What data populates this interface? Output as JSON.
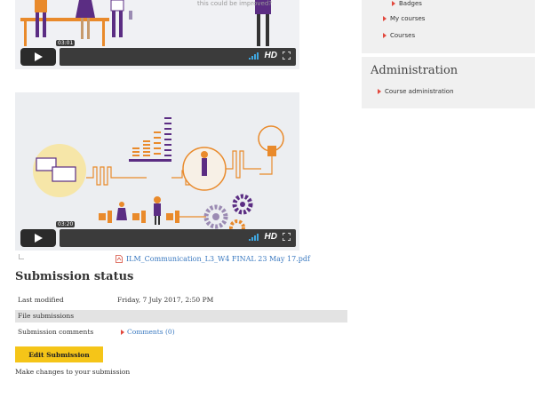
{
  "videos": [
    {
      "time": "03:01",
      "hd": "HD",
      "caption": "this could be improved?"
    },
    {
      "time": "03:20",
      "hd": "HD"
    }
  ],
  "attachment": {
    "filename": "ILM_Communication_L3_W4 FINAL 23 May 17.pdf"
  },
  "submission": {
    "title": "Submission status",
    "rows": [
      {
        "label": "Last modified",
        "value": "Friday, 7 July 2017, 2:50 PM"
      },
      {
        "label": "File submissions",
        "value": ""
      },
      {
        "label": "Submission comments",
        "value": "Comments (0)"
      }
    ],
    "edit_button": "Edit Submission",
    "help_text": "Make changes to your submission"
  },
  "navigation": {
    "items": [
      "Badges",
      "My courses",
      "Courses"
    ]
  },
  "administration": {
    "title": "Administration",
    "items": [
      "Course administration"
    ]
  },
  "colors": {
    "accent": "#f5c518",
    "link": "#3a79c0",
    "arrow": "#e2473c",
    "orange": "#e98a2b",
    "purple": "#5b2d83"
  }
}
